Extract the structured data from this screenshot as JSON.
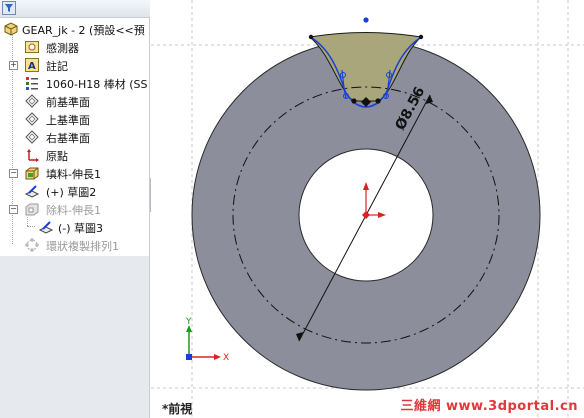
{
  "feature_tree": {
    "root": "GEAR_jk - 2 (預設<<預",
    "items": [
      {
        "label": "感測器",
        "icon": "sensor-icon",
        "disabled": false
      },
      {
        "label": "註記",
        "icon": "annotation-icon",
        "disabled": false
      },
      {
        "label": "1060-H18 棒材 (SS",
        "icon": "material-icon",
        "disabled": false
      },
      {
        "label": "前基準面",
        "icon": "plane-icon",
        "disabled": false
      },
      {
        "label": "上基準面",
        "icon": "plane-icon",
        "disabled": false
      },
      {
        "label": "右基準面",
        "icon": "plane-icon",
        "disabled": false
      },
      {
        "label": "原點",
        "icon": "origin-icon",
        "disabled": false
      },
      {
        "label": "填料-伸長1",
        "icon": "boss-extrude-icon",
        "disabled": false
      },
      {
        "label": "(+) 草圖2",
        "icon": "sketch-icon",
        "disabled": false
      },
      {
        "label": "除料-伸長1",
        "icon": "cut-extrude-icon",
        "disabled": true
      },
      {
        "label": "(-) 草圖3",
        "icon": "sketch-icon",
        "disabled": false
      },
      {
        "label": "環狀複製排列1",
        "icon": "circular-pattern-icon",
        "disabled": true
      }
    ]
  },
  "viewport": {
    "view_name": "*前視",
    "dimension_label": "Ø8.56",
    "colors": {
      "part_face": "#8c8f9b",
      "profile_fill": "#a8a67a",
      "sketch_line": "#1a3fd8",
      "axis_x": "#e02020",
      "axis_y": "#1e9a1e"
    }
  },
  "watermark": "三維網 www.3dportal.cn"
}
